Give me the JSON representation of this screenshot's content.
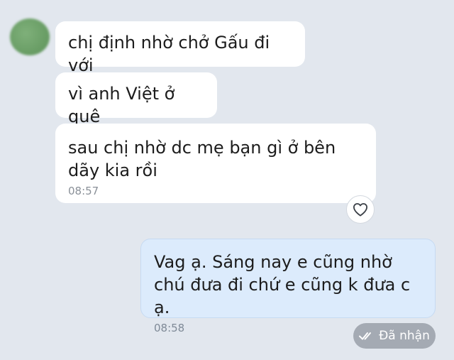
{
  "messages": {
    "incoming": [
      {
        "text": "chị định nhờ chở Gấu đi với"
      },
      {
        "text": "vì anh Việt ở quê"
      },
      {
        "text": "sau chị nhờ dc mẹ bạn gì ở bên dãy kia rồi",
        "time": "08:57"
      }
    ],
    "outgoing": [
      {
        "text": "Vag ạ. Sáng nay e cũng nhờ chú đưa đi chứ e cũng k đưa c ạ.",
        "time": "08:58"
      }
    ]
  },
  "status": {
    "label": "Đã nhận",
    "icon": "double-check-icon"
  },
  "reaction": {
    "icon": "heart-icon"
  },
  "colors": {
    "background": "#e2e7ee",
    "incoming_bubble": "#ffffff",
    "outgoing_bubble": "#dcebfc",
    "status_badge": "#a4aab3",
    "avatar": "#6a9e66"
  }
}
